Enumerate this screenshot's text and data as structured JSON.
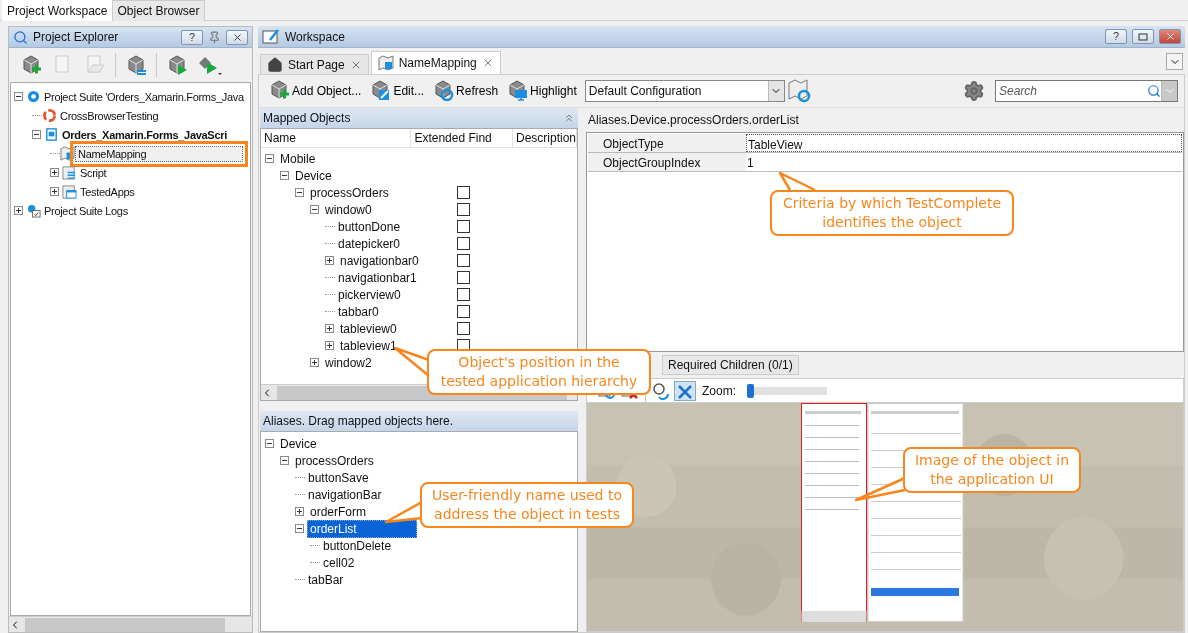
{
  "top_tabs": [
    {
      "label": "Project Workspace",
      "selected": true
    },
    {
      "label": "Object Browser",
      "selected": false
    }
  ],
  "project_explorer": {
    "title": "Project Explorer",
    "help_button": "?",
    "tree": [
      {
        "label": "Project Suite 'Orders_Xamarin.Forms_Java",
        "kind": "suite",
        "bold": false,
        "outlined": false,
        "expanded": true,
        "children": [
          {
            "label": "CrossBrowserTesting",
            "kind": "cbt",
            "bold": false,
            "outlined": false
          },
          {
            "label": "Orders_Xamarin.Forms_JavaScri",
            "kind": "project",
            "bold": true,
            "outlined": false,
            "expanded": true,
            "children": [
              {
                "label": "NameMapping",
                "kind": "namemapping",
                "bold": false,
                "outlined": true
              },
              {
                "label": "Script",
                "kind": "script",
                "bold": false,
                "outlined": false,
                "expanded": false
              },
              {
                "label": "TestedApps",
                "kind": "testedapps",
                "bold": false,
                "outlined": false,
                "expanded": false
              }
            ]
          }
        ]
      },
      {
        "label": "Project Suite Logs",
        "kind": "logs",
        "bold": false,
        "outlined": false,
        "expanded": false
      }
    ]
  },
  "workspace": {
    "title": "Workspace",
    "help_button": "?",
    "tabs": [
      {
        "label": "Start Page",
        "kind": "home",
        "selected": false
      },
      {
        "label": "NameMapping",
        "kind": "namemapping",
        "selected": true
      }
    ],
    "toolbar": [
      {
        "label": "Add Object...",
        "kind": "add"
      },
      {
        "label": "Edit...",
        "kind": "edit"
      },
      {
        "label": "Refresh",
        "kind": "refresh"
      },
      {
        "label": "Highlight",
        "kind": "highlight"
      }
    ],
    "configuration": "Default Configuration",
    "search": {
      "placeholder": "Search"
    }
  },
  "mapped_objects": {
    "title": "Mapped Objects",
    "columns": [
      "Name",
      "Extended Find",
      "Description"
    ],
    "tree": [
      {
        "label": "Mobile",
        "expanded": true,
        "children": [
          {
            "label": "Device",
            "expanded": true,
            "children": [
              {
                "label": "processOrders",
                "expanded": true,
                "checked": false,
                "children": [
                  {
                    "label": "window0",
                    "expanded": true,
                    "checked": false,
                    "children": [
                      {
                        "label": "buttonDone",
                        "checked": false
                      },
                      {
                        "label": "datepicker0",
                        "checked": false
                      },
                      {
                        "label": "navigationbar0",
                        "expanded": false,
                        "checked": false
                      },
                      {
                        "label": "navigationbar1",
                        "checked": false
                      },
                      {
                        "label": "pickerview0",
                        "checked": false
                      },
                      {
                        "label": "tabbar0",
                        "checked": false
                      },
                      {
                        "label": "tableview0",
                        "expanded": false,
                        "checked": false
                      },
                      {
                        "label": "tableview1",
                        "expanded": false,
                        "checked": false
                      }
                    ]
                  },
                  {
                    "label": "window2",
                    "expanded": false
                  }
                ]
              }
            ]
          }
        ]
      }
    ]
  },
  "aliases": {
    "title": "Aliases. Drag mapped objects here.",
    "tree": [
      {
        "label": "Device",
        "expanded": true,
        "selected": false,
        "children": [
          {
            "label": "processOrders",
            "expanded": true,
            "selected": false,
            "children": [
              {
                "label": "buttonSave",
                "selected": false
              },
              {
                "label": "navigationBar",
                "selected": false
              },
              {
                "label": "orderForm",
                "expanded": false,
                "selected": false
              },
              {
                "label": "orderList",
                "expanded": true,
                "selected": true,
                "children": [
                  {
                    "label": "buttonDelete",
                    "selected": false
                  },
                  {
                    "label": "cell02",
                    "selected": false
                  }
                ]
              },
              {
                "label": "tabBar",
                "selected": false
              }
            ]
          }
        ]
      }
    ]
  },
  "properties": {
    "path": "Aliases.Device.processOrders.orderList",
    "rows": [
      {
        "name": "ObjectType",
        "value": "TableView"
      },
      {
        "name": "ObjectGroupIndex",
        "value": "1"
      }
    ]
  },
  "detail_tabs": [
    {
      "label": "Required Children (0/1)",
      "selected": false
    }
  ],
  "image_viewer": {
    "zoom_label": "Zoom:",
    "zoom": {
      "level": 0.03
    }
  },
  "callouts": [
    {
      "text": "Criteria by which TestComplete identifies the object"
    },
    {
      "text": "Object's position in the tested application hierarchy"
    },
    {
      "text": "User-friendly name used to address the object in tests"
    },
    {
      "text": "Image of the object in the application UI"
    }
  ]
}
